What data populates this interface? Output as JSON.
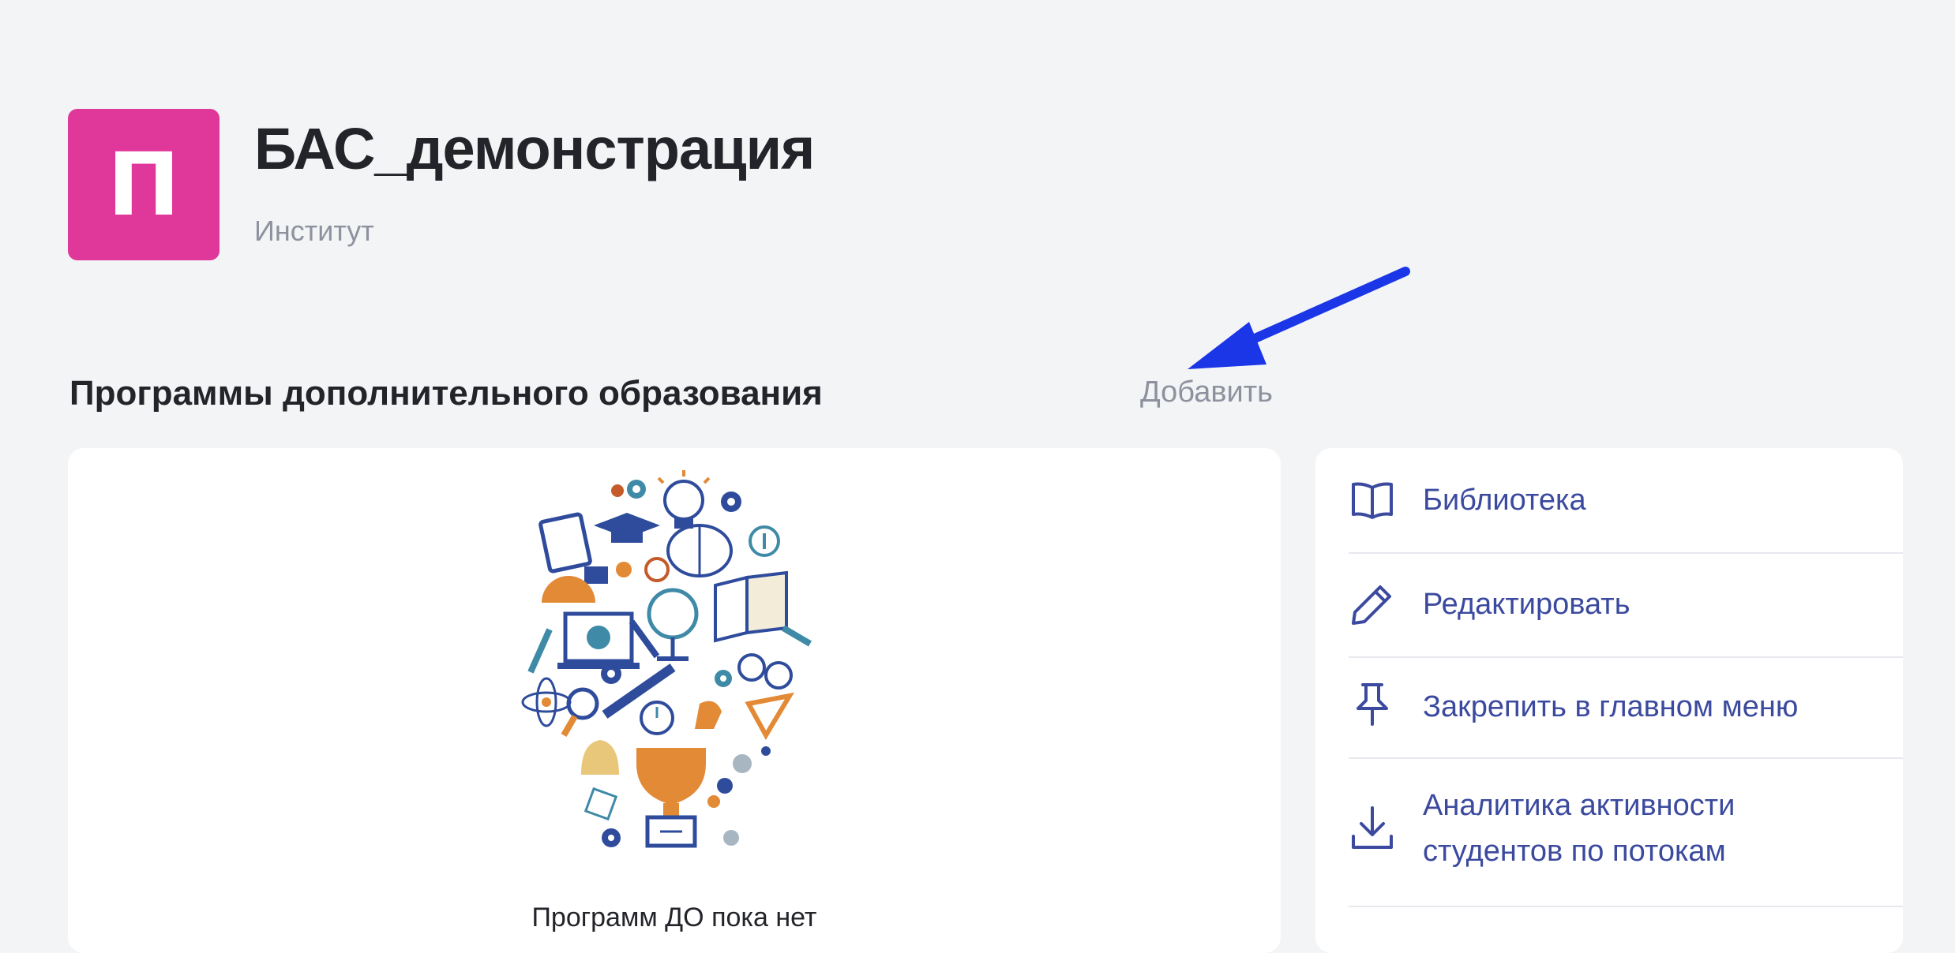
{
  "org": {
    "avatar_letter": "П",
    "title": "БАС_демонстрация",
    "subtitle": "Институт",
    "avatar_color": "#e0389a"
  },
  "section": {
    "title": "Программы дополнительного образования",
    "add_label": "Добавить"
  },
  "programs": {
    "empty_text": "Программ ДО пока нет"
  },
  "actions": [
    {
      "icon": "book-icon",
      "label": "Библиотека"
    },
    {
      "icon": "pencil-icon",
      "label": "Редактировать"
    },
    {
      "icon": "pin-icon",
      "label": "Закрепить в главном меню"
    },
    {
      "icon": "download-icon",
      "label": "Аналитика активности студентов по потокам"
    }
  ],
  "colors": {
    "accent": "#3b4a9e",
    "annotation_arrow": "#1a36e6",
    "background": "#f3f4f6"
  }
}
